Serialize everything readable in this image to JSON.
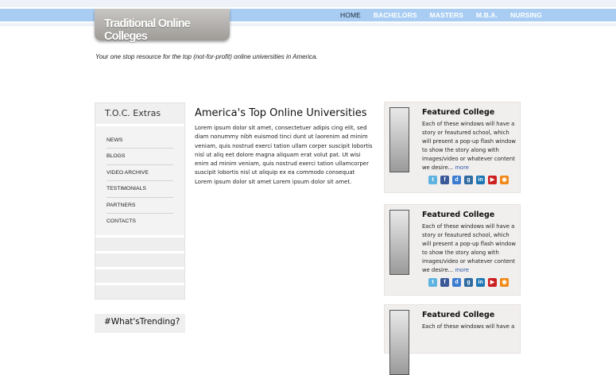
{
  "site": {
    "logo_text": "Traditional Online Colleges",
    "tagline": "Your one stop resource for the top (not-for-profit) online universities in America."
  },
  "nav": {
    "items": [
      {
        "label": "HOME"
      },
      {
        "label": "BACHELORS"
      },
      {
        "label": "MASTERS"
      },
      {
        "label": "M.B.A."
      },
      {
        "label": "NURSING"
      }
    ],
    "active": "HOME"
  },
  "sidebar": {
    "title": "T.O.C. Extras",
    "items": [
      {
        "label": "NEWS"
      },
      {
        "label": "BLOGS"
      },
      {
        "label": "VIDEO ARCHIVE"
      },
      {
        "label": "TESTIMONIALS"
      },
      {
        "label": "PARTNERS"
      },
      {
        "label": "CONTACTS"
      }
    ],
    "trending_title": "#What'sTrending?"
  },
  "main": {
    "title": "America's Top Online Universities",
    "body": "Lorem ipsum dolor sit amet, consectetuer adipis cing elit, sed diam nonummy nibh euismod tinci dunt ut laorenim ad minim veniam, quis nostrud exerci tation ullam corper suscipit lobortis nisl ut aliq eet dolore magna aliquam erat volut pat. Ut wisi enim ad minim veniam, quis nostrud exerci tation ullamcorper suscipit lobortis nisl ut aliquip ex ea commodo consequat Lorem ipsum dolor sit amet Lorem ipsum dolor sit amet."
  },
  "featured": [
    {
      "title": "Featured College",
      "text": "Each of these windows will have a story or feautured school, which will present a pop-up flash window to show the story along with images/video or whatever content we desire...",
      "more": "more"
    },
    {
      "title": "Featured College",
      "text": "Each of these windows will have a story or feautured school, which will present a pop-up flash window to show the story along with images/video or whatever content we desire...",
      "more": "more"
    },
    {
      "title": "Featured College",
      "text": "Each of these windows will have a",
      "more": ""
    }
  ],
  "social_icons": [
    "twitter-icon",
    "facebook-icon",
    "delicious-icon",
    "digg-icon",
    "linkedin-icon",
    "youtube-icon",
    "rss-icon"
  ],
  "colors": {
    "nav_bar": "#a9cdf2",
    "link": "#2a55a5"
  }
}
